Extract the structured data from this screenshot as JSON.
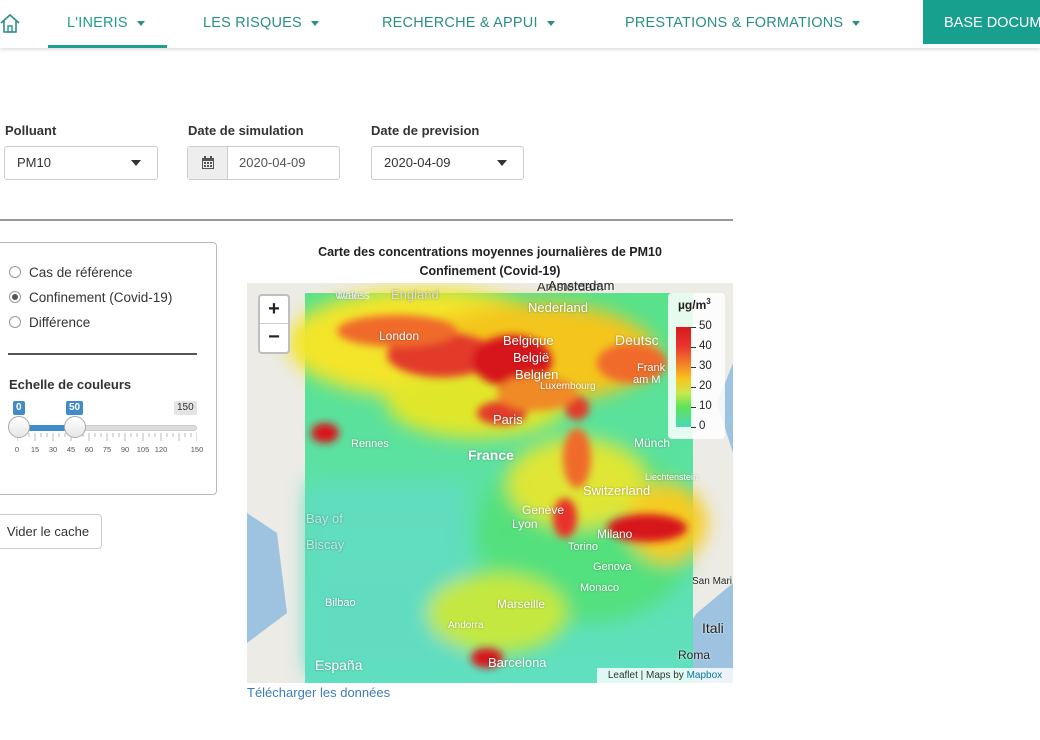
{
  "nav": {
    "items": [
      {
        "label": "L'INERIS"
      },
      {
        "label": "LES RISQUES"
      },
      {
        "label": "RECHERCHE & APPUI"
      },
      {
        "label": "PRESTATIONS & FORMATIONS"
      }
    ],
    "base_label": "BASE DOCUM",
    "accent": "#1e9e8d"
  },
  "form": {
    "polluant_label": "Polluant",
    "polluant_value": "PM10",
    "date_sim_label": "Date de simulation",
    "date_sim_value": "2020-04-09",
    "date_prev_label": "Date de prevision",
    "date_prev_value": "2020-04-09"
  },
  "panel": {
    "radios": [
      {
        "label": "Cas de référence",
        "selected": false
      },
      {
        "label": "Confinement (Covid-19)",
        "selected": true
      },
      {
        "label": "Différence",
        "selected": false
      }
    ],
    "scale_label": "Echelle de couleurs",
    "slider": {
      "min": 0,
      "max": 150,
      "from": 0,
      "to": 50,
      "from_label": "0",
      "to_label": "50",
      "max_label": "150",
      "tick_labels": [
        "0",
        "15",
        "30",
        "45",
        "60",
        "75",
        "90",
        "105",
        "120",
        "150"
      ]
    },
    "clear_button": "Vider le cache"
  },
  "map": {
    "title_line1": "Carte des concentrations moyennes journalières de PM10",
    "title_line2": "Confinement (Covid-19)",
    "zoom_in": "+",
    "zoom_out": "−",
    "legend_unit": "µg/m",
    "legend_unit_sup": "3",
    "legend_ticks": [
      "50",
      "40",
      "30",
      "20",
      "10",
      "0"
    ],
    "attribution_prefix": "Leaflet | Maps by ",
    "attribution_link": "Mapbox",
    "place_labels": [
      "Amsterdam",
      "Wales",
      "England",
      "London",
      "Nederland",
      "Belgique",
      "België",
      "Belgien",
      "Luxembourg",
      "Deutsc",
      "Frank",
      "am M",
      "Paris",
      "Rennes",
      "France",
      "Münch",
      "Liechtenstein",
      "Switzerland",
      "Genève",
      "Lyon",
      "Milano",
      "Torino",
      "Genova",
      "Monaco",
      "San Mari",
      "Bay of",
      "Biscay",
      "Bilbao",
      "Marseille",
      "Andorra",
      "Itali",
      "Roma",
      "España",
      "Barcelona"
    ],
    "download_link": "Télécharger les données"
  }
}
